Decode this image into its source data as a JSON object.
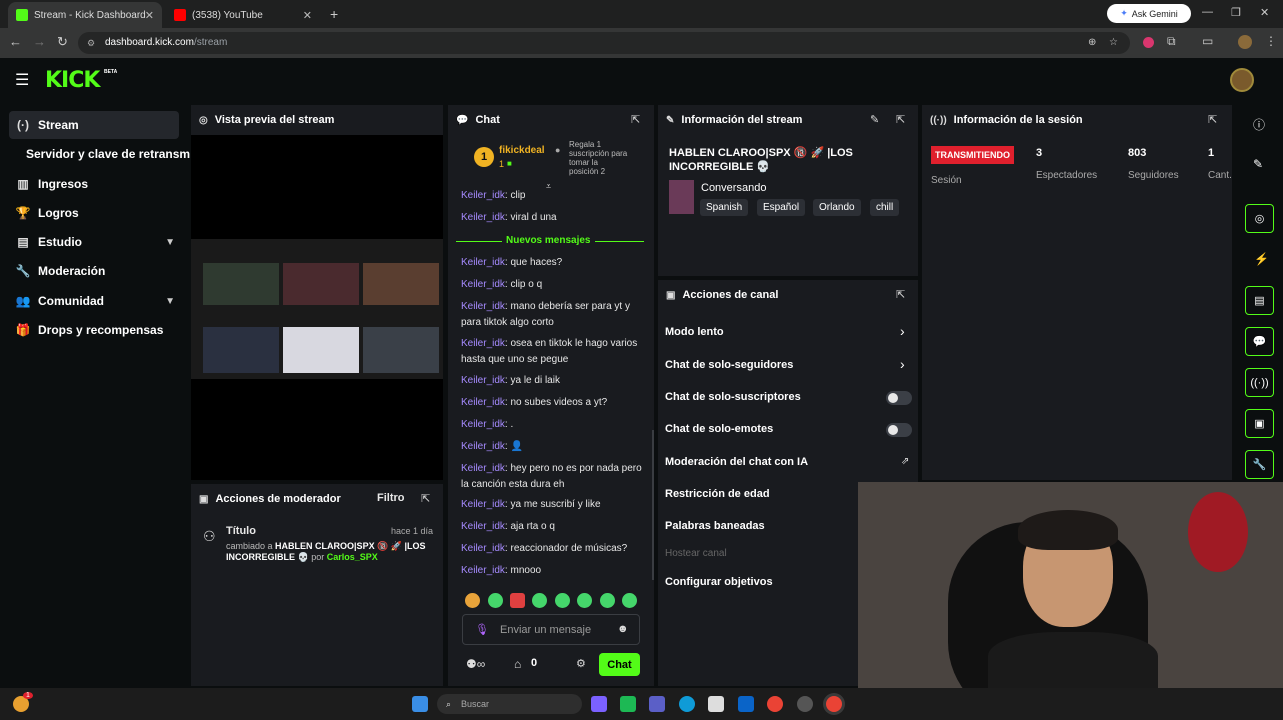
{
  "browser": {
    "tabs": [
      {
        "title": "Stream - Kick Dashboard"
      },
      {
        "title": "(3538) YouTube"
      }
    ],
    "url_host": "dashboard.kick.com",
    "url_path": "/stream",
    "gemini_label": "Ask Gemini"
  },
  "header": {
    "logo": "KICK",
    "badge": "BETA"
  },
  "sidebar": {
    "items": [
      {
        "label": "Stream"
      },
      {
        "label": "Servidor y clave de retransm"
      },
      {
        "label": "Ingresos"
      },
      {
        "label": "Logros"
      },
      {
        "label": "Estudio"
      },
      {
        "label": "Moderación"
      },
      {
        "label": "Comunidad"
      },
      {
        "label": "Drops y recompensas"
      }
    ]
  },
  "preview": {
    "title": "Vista previa del stream"
  },
  "mod_actions": {
    "title": "Acciones de moderador",
    "filter": "Filtro",
    "entry": {
      "label": "Título",
      "time": "hace 1 día",
      "change_prefix": "cambiado a",
      "change_title": "HABLEN CLAROO|SPX 🔞 🚀 |LOS INCORREGIBLE 💀",
      "by": "por",
      "author": "Carlos_SPX"
    }
  },
  "chat": {
    "title": "Chat",
    "top_gifter": {
      "name": "fikickdeal",
      "rank": "1",
      "count": "1"
    },
    "gift_text": "Regala 1 suscripción para tomar la posición 2",
    "new_messages": "Nuevos mensajes",
    "messages": [
      {
        "user": "Keiler_idk",
        "text": "clip"
      },
      {
        "user": "Keiler_idk",
        "text": "viral d una"
      },
      {
        "user": "Keiler_idk",
        "text": "que haces?"
      },
      {
        "user": "Keiler_idk",
        "text": "clip o q"
      },
      {
        "user": "Keiler_idk",
        "text": "mano debería ser para yt y para tiktok algo corto"
      },
      {
        "user": "Keiler_idk",
        "text": "osea en tiktok le hago varios hasta que uno se pegue"
      },
      {
        "user": "Keiler_idk",
        "text": "ya le di laik"
      },
      {
        "user": "Keiler_idk",
        "text": "no subes videos a yt?"
      },
      {
        "user": "Keiler_idk",
        "text": "."
      },
      {
        "user": "Keiler_idk",
        "text": "👤"
      },
      {
        "user": "Keiler_idk",
        "text": "hey pero no es por nada pero la canción esta dura eh"
      },
      {
        "user": "Keiler_idk",
        "text": "ya me suscribí y like"
      },
      {
        "user": "Keiler_idk",
        "text": "aja rta o q"
      },
      {
        "user": "Keiler_idk",
        "text": "reaccionador de músicas?"
      },
      {
        "user": "Keiler_idk",
        "text": "mnooo"
      }
    ],
    "input_placeholder": "Enviar un mensaje",
    "points": "0",
    "send_label": "Chat"
  },
  "stream_info": {
    "title": "Información del stream",
    "stream_title": "HABLEN CLAROO|SPX 🔞 🚀 |LOS INCORREGIBLE 💀",
    "category": "Conversando",
    "tags": [
      "Spanish",
      "Español",
      "Orlando",
      "chill"
    ]
  },
  "session": {
    "title": "Información de la sesión",
    "status": "TRANSMITIENDO",
    "status_label": "Sesión",
    "stats": [
      {
        "value": "3",
        "label": "Espectadores"
      },
      {
        "value": "803",
        "label": "Seguidores"
      },
      {
        "value": "1",
        "label": "Cant. susc"
      }
    ]
  },
  "channel_actions": {
    "title": "Acciones de canal",
    "items": [
      {
        "label": "Modo lento"
      },
      {
        "label": "Chat de solo-seguidores"
      },
      {
        "label": "Chat de solo-suscriptores"
      },
      {
        "label": "Chat de solo-emotes"
      },
      {
        "label": "Moderación del chat con IA"
      },
      {
        "label": "Restricción de edad"
      },
      {
        "label": "Palabras baneadas"
      },
      {
        "label": "Hostear canal"
      },
      {
        "label": "Configurar objetivos"
      }
    ]
  },
  "taskbar": {
    "search_placeholder": "Buscar",
    "notif_count": "1"
  },
  "colors": {
    "accent": "#53fc18",
    "live": "#e0202d",
    "username": "#a68bff",
    "panel": "#191b1f",
    "bg": "#0b0e0f"
  }
}
